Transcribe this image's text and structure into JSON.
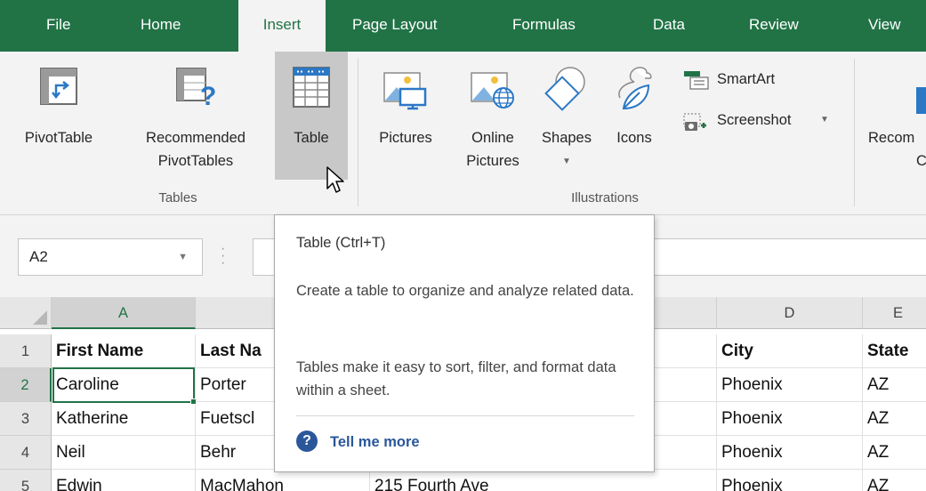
{
  "ribbon_tabs": [
    "File",
    "Home",
    "Insert",
    "Page Layout",
    "Formulas",
    "Data",
    "Review",
    "View"
  ],
  "active_tab": "Insert",
  "ribbon": {
    "tables_group": {
      "label": "Tables",
      "pivottable": "PivotTable",
      "recommended_line1": "Recommended",
      "recommended_line2": "PivotTables",
      "table": "Table"
    },
    "illustrations_group": {
      "label": "Illustrations",
      "pictures": "Pictures",
      "online_line1": "Online",
      "online_line2": "Pictures",
      "shapes": "Shapes",
      "icons": "Icons",
      "smartart": "SmartArt",
      "screenshot": "Screenshot"
    },
    "charts_partial_line1": "Recom",
    "charts_partial_line2": "Cl"
  },
  "name_box": "A2",
  "columns": [
    "A",
    "D",
    "E"
  ],
  "rows": [
    {
      "num": "1",
      "a": "First Name",
      "b": "Last Na",
      "d": "City",
      "e": "State"
    },
    {
      "num": "2",
      "a": "Caroline",
      "b": "Porter",
      "d": "Phoenix",
      "e": "AZ"
    },
    {
      "num": "3",
      "a": "Katherine",
      "b": "Fuetscl",
      "d": "Phoenix",
      "e": "AZ"
    },
    {
      "num": "4",
      "a": "Neil",
      "b": "Behr",
      "d": "Phoenix",
      "e": "AZ"
    },
    {
      "num": "5",
      "a": "Edwin",
      "b": "MacMahon",
      "c": "215 Fourth Ave",
      "d": "Phoenix",
      "e": "AZ"
    }
  ],
  "tooltip": {
    "title": "Table (Ctrl+T)",
    "para1": "Create a table to organize and analyze related data.",
    "para2": "Tables make it easy to sort, filter, and format data within a sheet.",
    "help": "Tell me more"
  },
  "colors": {
    "excel_green": "#217346",
    "ribbon_bg": "#f3f3f3",
    "hover_gray": "#c8c8c8",
    "link_blue": "#2b579a"
  }
}
